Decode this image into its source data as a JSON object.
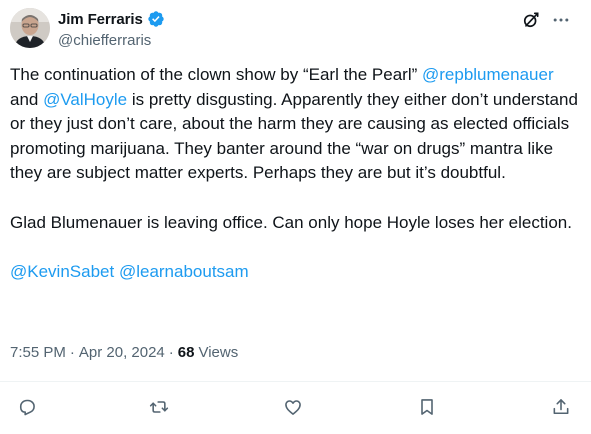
{
  "author": {
    "display_name": "Jim Ferraris",
    "handle": "@chiefferraris",
    "verified": true
  },
  "header_icons": [
    "grok-icon",
    "more-icon"
  ],
  "tweet": {
    "paragraph1": {
      "part1": "The continuation of the clown show by “Earl the Pearl” ",
      "mention1": "@repblumenauer",
      "part2": " and ",
      "mention2": "@ValHoyle",
      "part3": " is pretty disgusting. Apparently they either don’t understand or they just don’t care, about the harm they are causing as elected officials promoting marijuana.  They banter around the “war on drugs” mantra like they are subject matter experts. Perhaps they are but it’s doubtful."
    },
    "paragraph2": "Glad Blumenauer is leaving office. Can only hope Hoyle loses her election.",
    "paragraph3": {
      "mention1": "@KevinSabet",
      "mention2": "@learnaboutsam"
    }
  },
  "meta": {
    "time": "7:55 PM",
    "date": "Apr 20, 2024",
    "views_count": "68",
    "views_label": "Views"
  },
  "action_icons": [
    "reply-icon",
    "retweet-icon",
    "like-icon",
    "bookmark-icon",
    "share-icon"
  ],
  "colors": {
    "text": "#0f1419",
    "secondary": "#536471",
    "link": "#1d9bf0",
    "divider": "#eff3f4"
  }
}
